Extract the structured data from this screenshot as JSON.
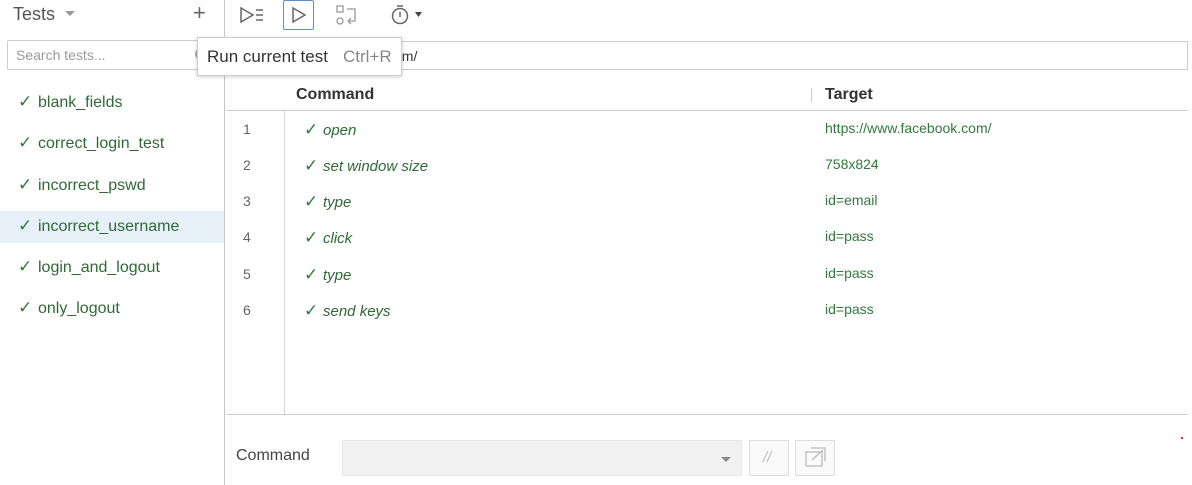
{
  "sidebar": {
    "title": "Tests",
    "add_label": "+",
    "search_placeholder": "Search tests...",
    "items": [
      {
        "label": "blank_fields",
        "status": "passed"
      },
      {
        "label": "correct_login_test",
        "status": "passed"
      },
      {
        "label": "incorrect_pswd",
        "status": "passed"
      },
      {
        "label": "incorrect_username",
        "status": "passed",
        "selected": true
      },
      {
        "label": "login_and_logout",
        "status": "passed"
      },
      {
        "label": "only_logout",
        "status": "passed"
      }
    ],
    "check_glyph": "✓"
  },
  "toolbar": {
    "icons": [
      "run-all-tests-icon",
      "run-current-test-icon",
      "step-over-icon",
      "speed-timer-icon"
    ]
  },
  "tooltip": {
    "text": "Run current test",
    "shortcut": "Ctrl+R"
  },
  "url_bar": {
    "visible_text": "om/"
  },
  "table": {
    "headers": {
      "command": "Command",
      "target": "Target"
    },
    "rows": [
      {
        "num": "1",
        "command": "open",
        "target": "https://www.facebook.com/"
      },
      {
        "num": "2",
        "command": "set window size",
        "target": "758x824"
      },
      {
        "num": "3",
        "command": "type",
        "target": "id=email"
      },
      {
        "num": "4",
        "command": "click",
        "target": "id=pass"
      },
      {
        "num": "5",
        "command": "type",
        "target": "id=pass"
      },
      {
        "num": "6",
        "command": "send keys",
        "target": "id=pass"
      }
    ]
  },
  "editor": {
    "command_label": "Command",
    "command_value": "",
    "comment_label": "//"
  },
  "colors": {
    "pass_green": "#2f7a3e",
    "selected_bg": "#e6f0f8",
    "accent_blue": "#5a8fc6"
  }
}
